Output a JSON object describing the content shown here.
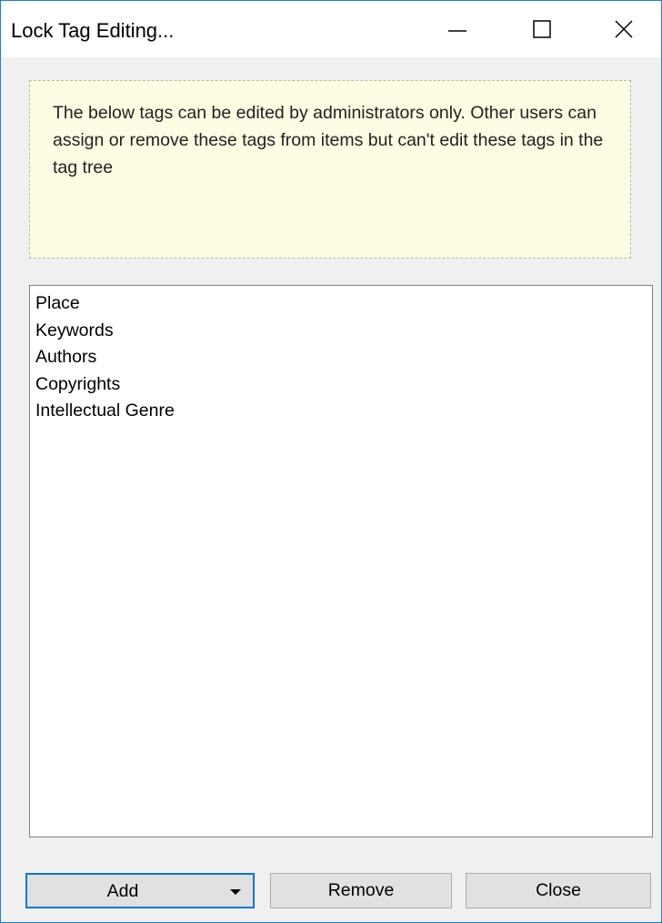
{
  "window": {
    "title": "Lock Tag Editing...",
    "controls": {
      "minimize": "minimize-icon",
      "maximize": "maximize-icon",
      "close": "close-icon"
    }
  },
  "info": {
    "message": "The below tags can be edited by administrators only. Other users can assign or remove these tags from items but can't edit these tags in the tag tree"
  },
  "tags": {
    "items": [
      {
        "label": "Place"
      },
      {
        "label": "Keywords"
      },
      {
        "label": "Authors"
      },
      {
        "label": "Copyrights"
      },
      {
        "label": "Intellectual Genre"
      }
    ]
  },
  "buttons": {
    "add_label": "Add",
    "add_dropdown_icon": "triangle-down-icon",
    "remove_label": "Remove",
    "close_label": "Close"
  },
  "colors": {
    "window_border": "#1883d7",
    "info_background": "#fdfde3",
    "default_button_border": "#0078d7"
  }
}
